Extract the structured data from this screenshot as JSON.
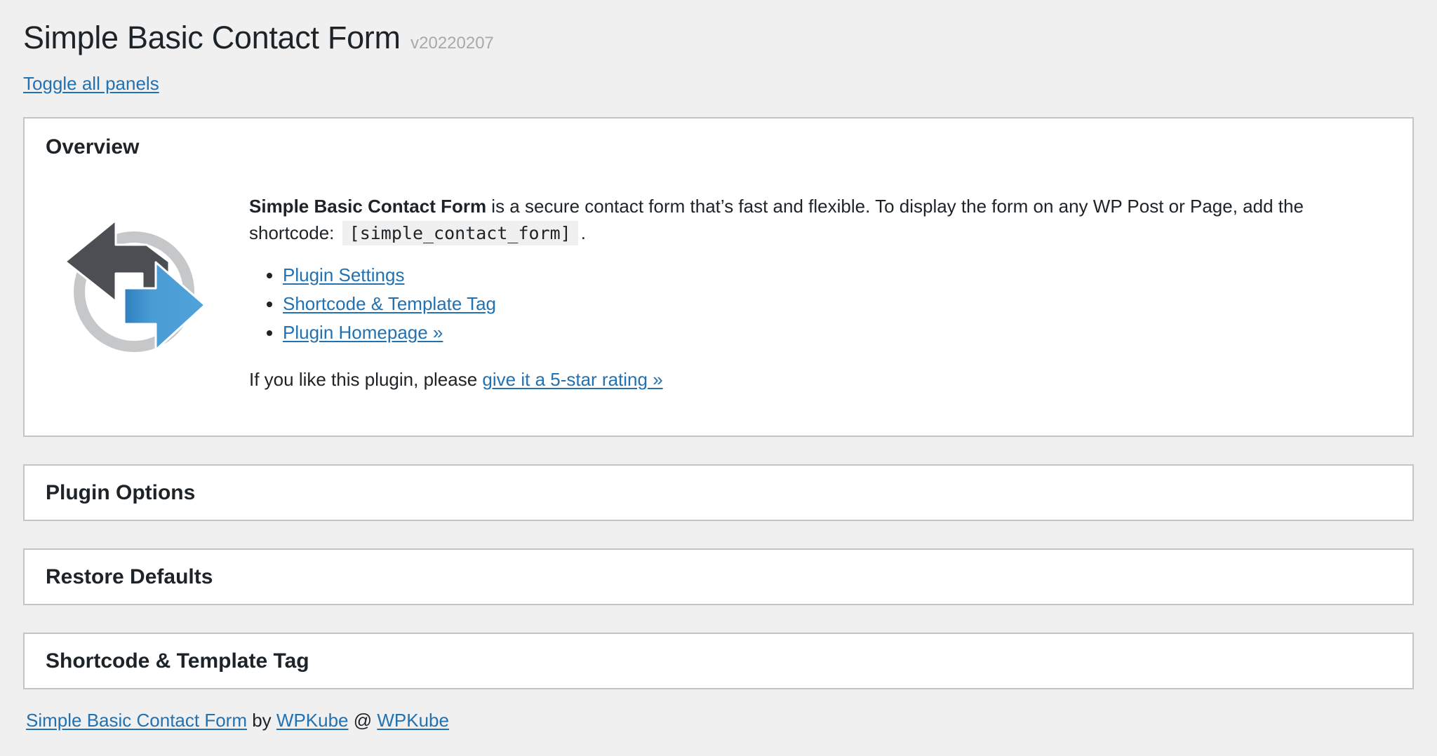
{
  "header": {
    "title": "Simple Basic Contact Form",
    "version": "v20220207",
    "toggle_label": "Toggle all panels"
  },
  "overview": {
    "title": "Overview",
    "logo_icon": "plugin-logo-arrows-icon",
    "plugin_name": "Simple Basic Contact Form",
    "description_text": " is a secure contact form that’s fast and flexible. To display the form on any WP Post or Page, add the shortcode:",
    "shortcode": "[simple_contact_form]",
    "period": ".",
    "links": [
      "Plugin Settings",
      "Shortcode & Template Tag",
      "Plugin Homepage »"
    ],
    "rating_prefix": "If you like this plugin, please ",
    "rating_link": "give it a 5-star rating »"
  },
  "panels": {
    "plugin_options": "Plugin Options",
    "restore_defaults": "Restore Defaults",
    "shortcode_template": "Shortcode & Template Tag"
  },
  "footer": {
    "plugin_link": "Simple Basic Contact Form",
    "by": " by ",
    "author_link": "WPKube",
    "at": " @ ",
    "site_link": "WPKube"
  },
  "colors": {
    "link": "#2271b1",
    "background": "#f0f0f1",
    "logo_dark": "#4b4f54",
    "logo_blue": "#4a9dd4",
    "logo_ring": "#c5c7c9"
  }
}
